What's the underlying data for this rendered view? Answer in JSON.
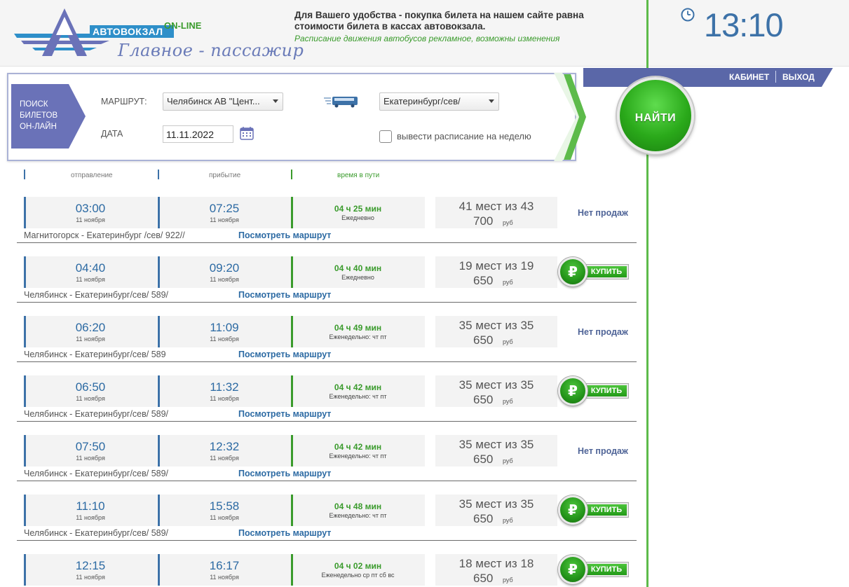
{
  "header": {
    "logo_text": "АВТОВОКЗАЛ",
    "logo_online": "ON-LINE",
    "logo_script": "Главное - пассажир",
    "promo_main": "Для Вашего удобства - покупка билета на нашем сайте равна стоимости билета в кассах автовокзала.",
    "promo_sub": "Расписание движения автобусов рекламное, возможны изменения",
    "clock": "13:10"
  },
  "account": {
    "cabinet": "КАБИНЕТ",
    "logout": "ВЫХОД"
  },
  "search": {
    "tag_label": "ПОИСК БИЛЕТОВ ОН-ЛАЙН",
    "route_label": "МАРШРУТ:",
    "from_value": "Челябинск АВ \"Цент...",
    "to_value": "Екатеринбург/сев/",
    "date_label": "ДАТА",
    "date_value": "11.11.2022",
    "week_label": "вывести расписание на неделю",
    "find_label": "НАЙТИ"
  },
  "columns": {
    "departure": "отправление",
    "arrival": "прибытие",
    "travel_time": "время в пути"
  },
  "colors": {
    "blue": "#2c6aa3",
    "green": "#3a9b2c",
    "purple": "#6a72b8"
  },
  "trips": [
    {
      "dep": "03:00",
      "dep_date": "11 ноября",
      "arr": "07:25",
      "arr_date": "11 ноября",
      "duration": "04 ч 25 мин",
      "freq": "Ежедневно",
      "seats": "41 мест из 43",
      "price": "700",
      "currency": "руб",
      "action": "no_sale",
      "no_sale_text": "Нет продаж",
      "route": "Магнитогорск - Екатеринбург /сев/ 922//",
      "route_link": "Посмотреть маршрут"
    },
    {
      "dep": "04:40",
      "dep_date": "11 ноября",
      "arr": "09:20",
      "arr_date": "11 ноября",
      "duration": "04 ч 40 мин",
      "freq": "Ежедневно",
      "seats": "19 мест из 19",
      "price": "650",
      "currency": "руб",
      "action": "buy",
      "buy_text": "КУПИТЬ",
      "route": "Челябинск - Екатеринбург/сев/ 589/",
      "route_link": "Посмотреть маршрут"
    },
    {
      "dep": "06:20",
      "dep_date": "11 ноября",
      "arr": "11:09",
      "arr_date": "11 ноября",
      "duration": "04 ч 49 мин",
      "freq": "Еженедельно: чт пт",
      "seats": "35 мест из 35",
      "price": "650",
      "currency": "руб",
      "action": "no_sale",
      "no_sale_text": "Нет продаж",
      "route": "Челябинск - Екатеринбург/сев/ 589",
      "route_link": "Посмотреть маршрут"
    },
    {
      "dep": "06:50",
      "dep_date": "11 ноября",
      "arr": "11:32",
      "arr_date": "11 ноября",
      "duration": "04 ч 42 мин",
      "freq": "Еженедельно: чт пт",
      "seats": "35 мест из 35",
      "price": "650",
      "currency": "руб",
      "action": "buy",
      "buy_text": "КУПИТЬ",
      "route": "Челябинск - Екатеринбург/сев/ 589/",
      "route_link": "Посмотреть маршрут"
    },
    {
      "dep": "07:50",
      "dep_date": "11 ноября",
      "arr": "12:32",
      "arr_date": "11 ноября",
      "duration": "04 ч 42 мин",
      "freq": "Еженедельно: чт пт",
      "seats": "35 мест из 35",
      "price": "650",
      "currency": "руб",
      "action": "no_sale",
      "no_sale_text": "Нет продаж",
      "route": "Челябинск - Екатеринбург/сев/ 589/",
      "route_link": "Посмотреть маршрут"
    },
    {
      "dep": "11:10",
      "dep_date": "11 ноября",
      "arr": "15:58",
      "arr_date": "11 ноября",
      "duration": "04 ч 48 мин",
      "freq": "Еженедельно: чт пт",
      "seats": "35 мест из 35",
      "price": "650",
      "currency": "руб",
      "action": "buy",
      "buy_text": "КУПИТЬ",
      "route": "Челябинск - Екатеринбург/сев/ 589/",
      "route_link": "Посмотреть маршрут"
    },
    {
      "dep": "12:15",
      "dep_date": "11 ноября",
      "arr": "16:17",
      "arr_date": "11 ноября",
      "duration": "04 ч 02 мин",
      "freq": "Еженедельно ср пт сб вс",
      "seats": "18 мест из 18",
      "price": "650",
      "currency": "руб",
      "action": "buy",
      "buy_text": "КУПИТЬ",
      "route": "",
      "route_link": ""
    }
  ]
}
